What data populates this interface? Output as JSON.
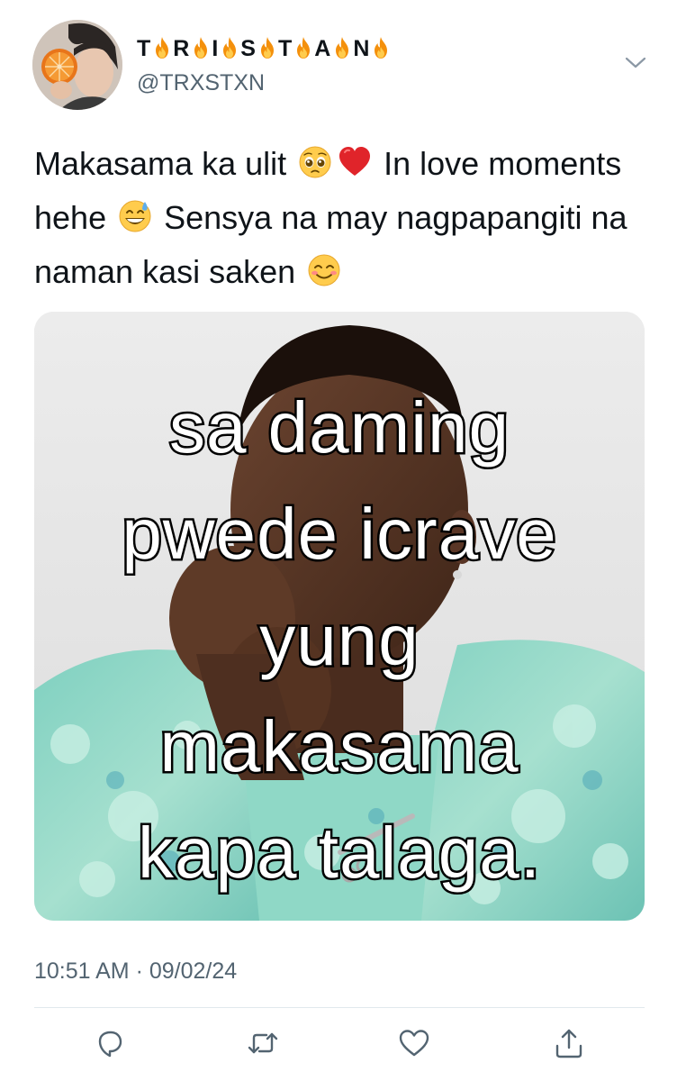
{
  "author": {
    "display_name_letters": [
      "T",
      "R",
      "I",
      "S",
      "T",
      "A",
      "N"
    ],
    "handle": "@TRXSTXN",
    "name_decoration_icon": "fire-emoji",
    "avatar_icon": "avatar-photo"
  },
  "tweet": {
    "text_part1": "Makasama ka ulit",
    "text_part2": "In love moments hehe",
    "text_part3": "Sensya na may nagpapangiti na naman kasi saken",
    "emojis": [
      "pleading-face",
      "red-heart",
      "grinning-sweat-face",
      "smiling-face"
    ]
  },
  "media": {
    "meme_lines": [
      "sa daming",
      "pwede icrave",
      "yung",
      "makasama",
      "kapa talaga."
    ]
  },
  "meta": {
    "time": "10:51 AM",
    "separator": "·",
    "date": "09/02/24"
  },
  "actions": [
    "reply-icon",
    "retweet-icon",
    "like-icon",
    "share-icon"
  ],
  "colors": {
    "text": "#0f1419",
    "secondary": "#536471",
    "divider": "#e1e8ed"
  }
}
